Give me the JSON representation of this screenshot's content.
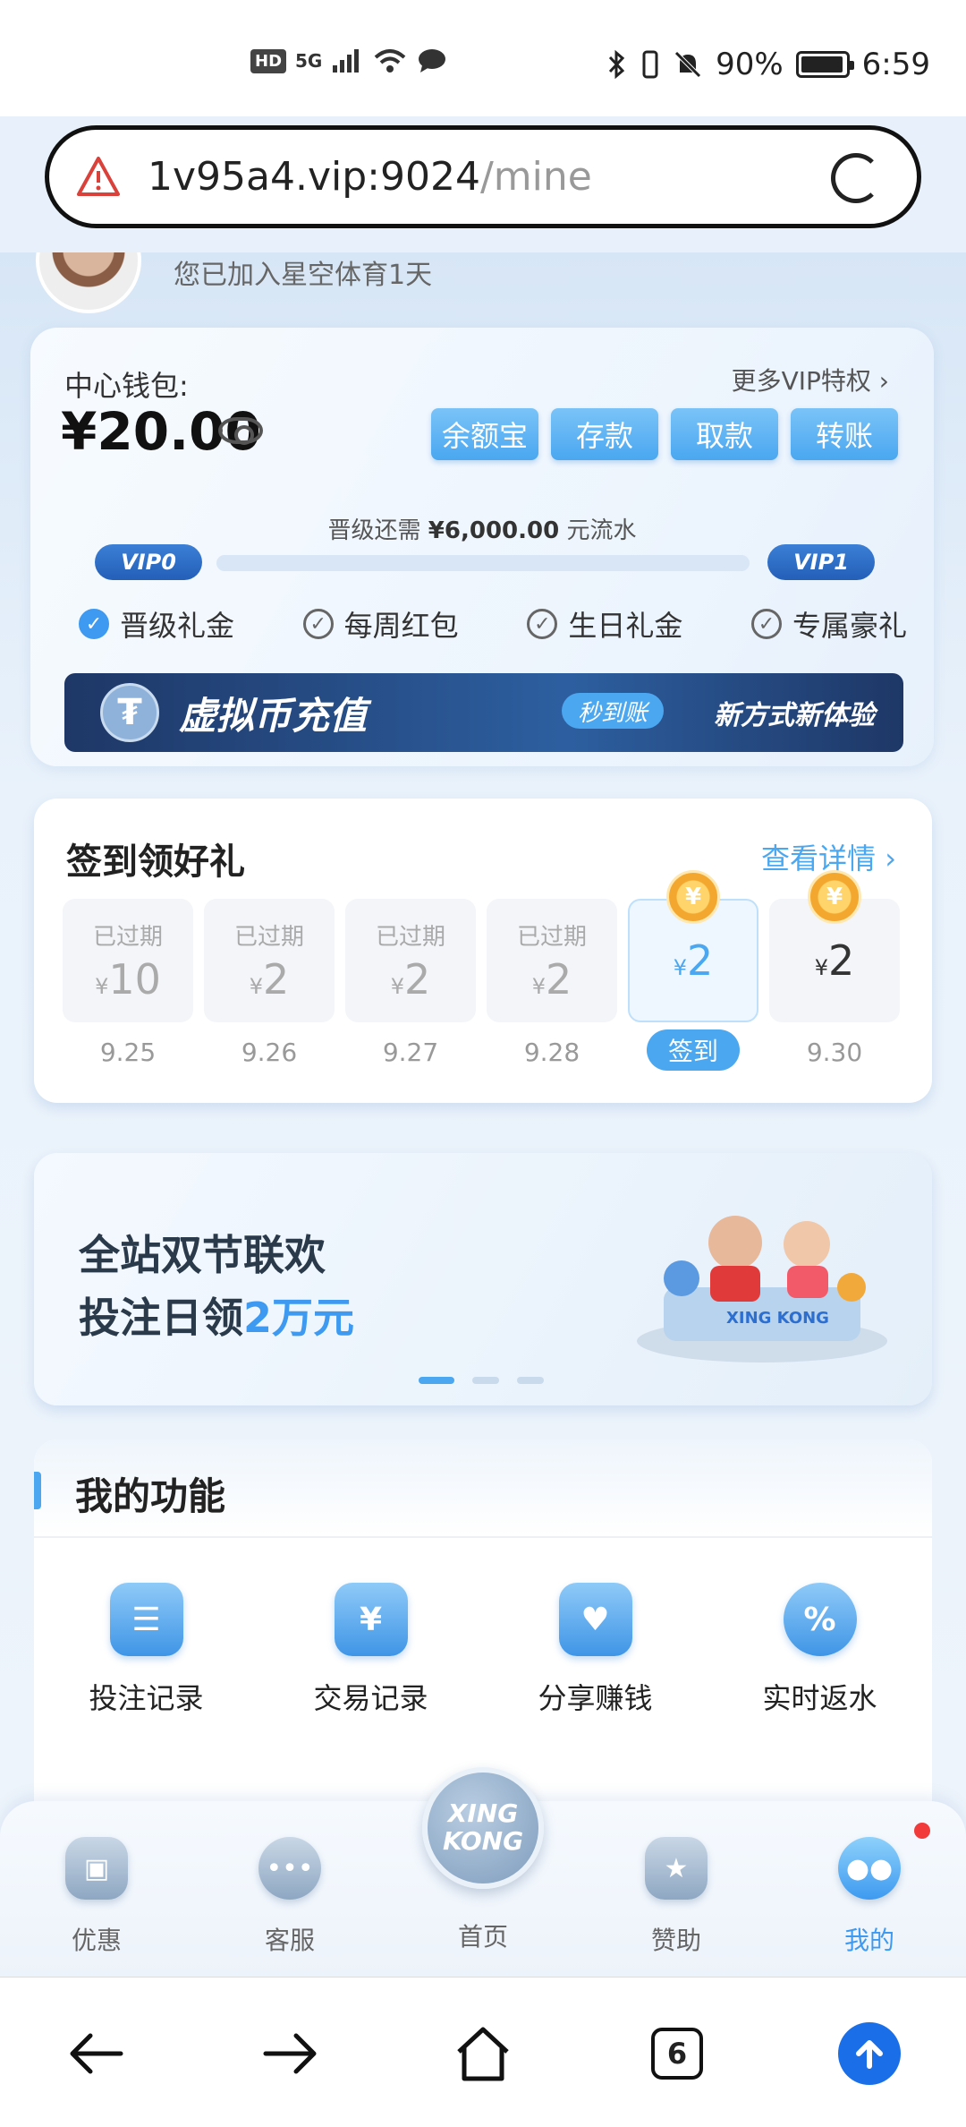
{
  "statusbar": {
    "hd": "HD",
    "network": "5G",
    "battery": "90%",
    "time": "6:59"
  },
  "browser": {
    "url_host": "1v95a4.vip:9024",
    "url_path": "/mine",
    "tabs_count": "6"
  },
  "profile": {
    "join_text": "您已加入星空体育1天"
  },
  "wallet": {
    "label": "中心钱包:",
    "amount": "¥20.00",
    "vip_more": "更多VIP特权 ›",
    "buttons": [
      "余额宝",
      "存款",
      "取款",
      "转账"
    ],
    "upgrade_prefix": "晋级还需",
    "upgrade_amount": "¥6,000.00",
    "upgrade_suffix": "元流水",
    "vip_current": "VIP0",
    "vip_next": "VIP1",
    "progress": 0.0,
    "perks": [
      {
        "label": "晋级礼金",
        "checked": true
      },
      {
        "label": "每周红包",
        "checked": false
      },
      {
        "label": "生日礼金",
        "checked": false
      },
      {
        "label": "专属豪礼",
        "checked": false
      }
    ],
    "crypto_title": "虚拟币充值",
    "crypto_tag": "秒到账",
    "crypto_sub": "新方式新体验"
  },
  "checkin": {
    "title": "签到领好礼",
    "more": "查看详情 ›",
    "expired_label": "已过期",
    "currency": "¥",
    "signin_label": "签到",
    "days": [
      {
        "amount": "10",
        "date": "9.25",
        "state": "expired"
      },
      {
        "amount": "2",
        "date": "9.26",
        "state": "expired"
      },
      {
        "amount": "2",
        "date": "9.27",
        "state": "expired"
      },
      {
        "amount": "2",
        "date": "9.28",
        "state": "expired"
      },
      {
        "amount": "2",
        "date": "",
        "state": "today"
      },
      {
        "amount": "2",
        "date": "9.30",
        "state": "future"
      }
    ]
  },
  "banner": {
    "line1": "全站双节联欢",
    "line2_prefix": "投注日领",
    "line2_highlight": "2万元",
    "art_text": "XING KONG"
  },
  "functions": {
    "title": "我的功能",
    "items": [
      {
        "label": "投注记录",
        "icon": "document-icon"
      },
      {
        "label": "交易记录",
        "icon": "yen-wallet-icon"
      },
      {
        "label": "分享赚钱",
        "icon": "heart-envelope-icon"
      },
      {
        "label": "实时返水",
        "icon": "percent-icon"
      }
    ]
  },
  "tabbar": {
    "items": [
      {
        "label": "优惠",
        "icon": "gift-icon"
      },
      {
        "label": "客服",
        "icon": "chat-icon"
      },
      {
        "label": "首页",
        "icon": "home-logo"
      },
      {
        "label": "赞助",
        "icon": "star-shield-icon"
      },
      {
        "label": "我的",
        "icon": "user-face-icon",
        "active": true
      }
    ],
    "home_logo": "XING KONG"
  }
}
